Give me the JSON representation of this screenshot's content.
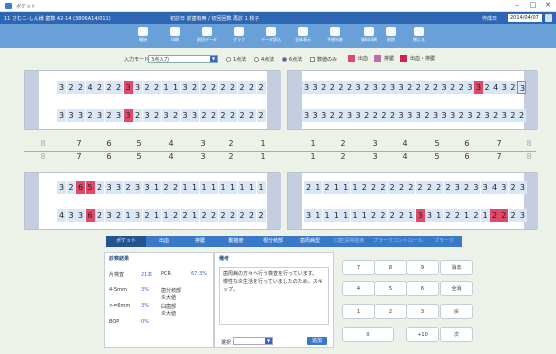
{
  "window": {
    "title": "ポケット",
    "minimize": "–",
    "maximize": "□",
    "close": "✕"
  },
  "infobar": {
    "clinic": "11 さむニ-しん様 歯数 42-14 (3806A14/011)",
    "patient": "初診日 前歯有無 / 初回回数 再診 1 枚子",
    "date_label": "作成日",
    "date": "2014/04/07"
  },
  "toolbar": {
    "items": [
      "開始",
      "印刷",
      "前回データ",
      "グラフ",
      "データ読込",
      "全体表示",
      "予想年齢",
      "資料印刷",
      "削除",
      "閉じる"
    ]
  },
  "options": {
    "mode_label": "入力モード",
    "mode_value": "3点入力",
    "radios": [
      "1点法",
      "4点法",
      "6点法"
    ],
    "checkbox": "数値のみ",
    "legend": [
      {
        "label": "出血",
        "color": "#e2486a"
      },
      {
        "label": "排膿",
        "color": "#c66aa8"
      },
      {
        "label": "出血・排膿",
        "color": "#d0244f"
      }
    ]
  },
  "chart": {
    "upper_left_row1": [
      "3",
      "2",
      "2",
      "4",
      "2",
      "2",
      "2",
      "3",
      "3",
      "2",
      "2",
      "1",
      "1",
      "3",
      "2",
      "2",
      "2",
      "2",
      "2",
      "2",
      "2",
      "2"
    ],
    "upper_left_row2": [
      "3",
      "3",
      "3",
      "2",
      "3",
      "2",
      "3",
      "3",
      "2",
      "3",
      "2",
      "3",
      "2",
      "3",
      "3",
      "2",
      "2",
      "2",
      "2",
      "2",
      "2",
      "2"
    ],
    "upper_right_row1": [
      "3",
      "3",
      "2",
      "2",
      "2",
      "2",
      "3",
      "2",
      "3",
      "2",
      "3",
      "3",
      "2",
      "2",
      "2",
      "2",
      "3",
      "2",
      "2",
      "3",
      "3",
      "2",
      "4",
      "3",
      "2",
      "3"
    ],
    "upper_right_row2": [
      "3",
      "3",
      "3",
      "2",
      "2",
      "3",
      "3",
      "2",
      "2",
      "2",
      "2",
      "3",
      "3",
      "3",
      "2",
      "3",
      "3",
      "3",
      "2",
      "3",
      "2",
      "3",
      "2",
      "3",
      "2",
      "2"
    ],
    "lower_left_row1": [
      "3",
      "2",
      "6",
      "5",
      "2",
      "3",
      "3",
      "2",
      "3",
      "3",
      "1",
      "2",
      "2",
      "1",
      "1",
      "1",
      "1",
      "1",
      "1",
      "1",
      "1",
      "1"
    ],
    "lower_left_row2": [
      "4",
      "3",
      "3",
      "6",
      "2",
      "3",
      "2",
      "1",
      "3",
      "2",
      "1",
      "1",
      "2",
      "2",
      "1",
      "2",
      "2",
      "2",
      "2",
      "2",
      "2",
      "2"
    ],
    "lower_right_row1": [
      "2",
      "1",
      "2",
      "1",
      "1",
      "1",
      "2",
      "2",
      "2",
      "2",
      "2",
      "2",
      "2",
      "2",
      "2",
      "2",
      "3",
      "2",
      "3",
      "3",
      "4",
      "3",
      "2",
      "3"
    ],
    "lower_right_row2": [
      "3",
      "1",
      "1",
      "1",
      "1",
      "1",
      "1",
      "2",
      "2",
      "2",
      "2",
      "1",
      "3",
      "3",
      "1",
      "2",
      "2",
      "1",
      "2",
      "1",
      "2",
      "2",
      "2",
      "3"
    ],
    "tooth_left_top": [
      "8",
      "7",
      "6",
      "5",
      "4",
      "3",
      "2",
      "1"
    ],
    "tooth_left_bottom": [
      "8",
      "7",
      "6",
      "5",
      "4",
      "3",
      "2",
      "1"
    ],
    "tooth_right_top": [
      "1",
      "2",
      "3",
      "4",
      "5",
      "6",
      "7",
      "8"
    ],
    "tooth_right_bottom": [
      "1",
      "2",
      "3",
      "4",
      "5",
      "6",
      "7",
      "8"
    ]
  },
  "tabs": [
    "ポケット",
    "出血",
    "排膿",
    "動揺度",
    "根分岐部",
    "歯周病型",
    "口腔清掃指導",
    "プラークコントロール",
    "プラーク"
  ],
  "summary": {
    "title": "診察結果",
    "rows": [
      {
        "label": "片検査",
        "value": "21本",
        "label2": "PCR",
        "value2": "67.3%"
      },
      {
        "label": "4-5mm",
        "value": "3%",
        "label2": "歯分岐部\n炎大値"
      },
      {
        "label": ">=6mm",
        "value": "3%",
        "label2": "臼歯部\n炎大値"
      },
      {
        "label": "BOP",
        "value": "0%"
      }
    ]
  },
  "notes": {
    "title": "備考",
    "text": "歯周病の方々へ行う検査を行っています。\n慢性な炎生活を行っていましたのため。スキップ。",
    "preset_label": "選択",
    "apply_label": "追加"
  },
  "keypad": {
    "keys": [
      "7",
      "8",
      "9",
      "消去",
      "4",
      "5",
      "6",
      "全消",
      "1",
      "2",
      "3",
      "戻",
      "0",
      "+10",
      "次"
    ]
  }
}
